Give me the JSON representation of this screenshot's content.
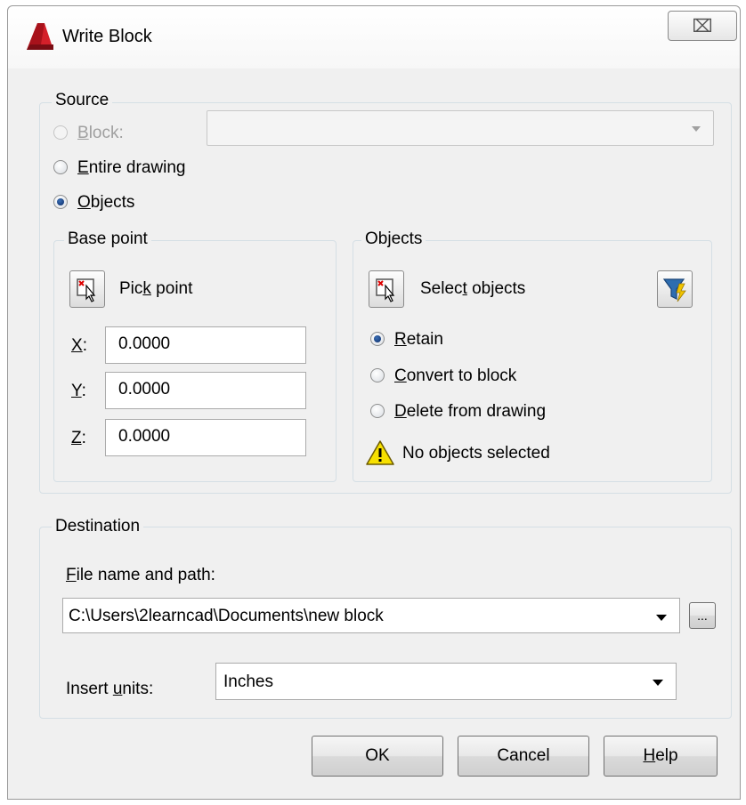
{
  "window": {
    "title": "Write Block",
    "close_glyph": "⌧"
  },
  "source": {
    "legend": "Source",
    "block": {
      "prefix": "",
      "u": "B",
      "rest": "lock:"
    },
    "entire": {
      "u": "E",
      "rest": "ntire drawing"
    },
    "objects": {
      "u": "O",
      "rest": "bjects"
    },
    "selected": "objects"
  },
  "base_point": {
    "legend": "Base point",
    "pick": {
      "pre": "Pic",
      "u": "k",
      "rest": " point"
    },
    "x": {
      "label_u": "X",
      "label_rest": ":",
      "value": "0.0000"
    },
    "y": {
      "label_u": "Y",
      "label_rest": ":",
      "value": "0.0000"
    },
    "z": {
      "label_u": "Z",
      "label_rest": ":",
      "value": "0.0000"
    }
  },
  "objects_group": {
    "legend": "Objects",
    "select": {
      "pre": "Selec",
      "u": "t",
      "rest": " objects"
    },
    "retain": {
      "u": "R",
      "rest": "etain"
    },
    "convert": {
      "u": "C",
      "rest": "onvert to block"
    },
    "delete": {
      "u": "D",
      "rest": "elete from drawing"
    },
    "selected": "retain",
    "warning": "No objects selected"
  },
  "destination": {
    "legend": "Destination",
    "file_label": {
      "u": "F",
      "rest": "ile name and path:"
    },
    "file_path": "C:\\Users\\2learncad\\Documents\\new block",
    "browse_label": "...",
    "units_label": {
      "pre": "Insert ",
      "u": "u",
      "rest": "nits:"
    },
    "units_value": "Inches"
  },
  "buttons": {
    "ok": "OK",
    "cancel": "Cancel",
    "help": {
      "u": "H",
      "rest": "elp"
    }
  },
  "colors": {
    "warning_fill": "#f7e000",
    "title_icon": "#d4202a",
    "filter_icon": "#2e6db0"
  }
}
